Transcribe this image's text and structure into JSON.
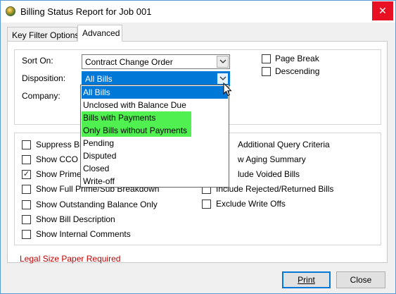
{
  "window": {
    "title": "Billing Status Report for Job 001",
    "close_glyph": "✕"
  },
  "tabs": [
    {
      "label": "Key Filter Options",
      "active": false
    },
    {
      "label": "Advanced",
      "active": true
    }
  ],
  "sort_group": {
    "sort_on_label": "Sort On:",
    "sort_on_value": "Contract Change Order",
    "disposition_label": "Disposition:",
    "disposition_value": "All Bills",
    "company_label": "Company:",
    "page_break_label": "Page Break",
    "page_break_checked": false,
    "descending_label": "Descending",
    "descending_checked": false
  },
  "disposition_dropdown": {
    "options": [
      "All Bills",
      "Unclosed with Balance Due",
      "Bills with Payments",
      "Only Bills without Payments",
      "Pending",
      "Disputed",
      "Closed",
      "Write-off"
    ],
    "selected": "All Bills",
    "highlight_color": "#50f050"
  },
  "options_left": [
    {
      "label": "Suppress Bill",
      "checked": false
    },
    {
      "label": "Show CCO B",
      "checked": false
    },
    {
      "label": "Show Prime/",
      "checked": true
    },
    {
      "label": "Show Full Prime/Sub Breakdown",
      "checked": false
    },
    {
      "label": "Show Outstanding Balance Only",
      "checked": false
    },
    {
      "label": "Show Bill Description",
      "checked": false
    },
    {
      "label": "Show Internal Comments",
      "checked": false
    }
  ],
  "options_right": [
    {
      "label": "Additional Query Criteria",
      "checked": false
    },
    {
      "label": "w Aging Summary",
      "checked": false
    },
    {
      "label": "lude Voided Bills",
      "checked": false
    },
    {
      "label": "Include Rejected/Returned Bills",
      "checked": false
    },
    {
      "label": "Exclude Write Offs",
      "checked": false
    }
  ],
  "footer": {
    "warning": "Legal Size Paper Required",
    "warning_color": "#c00000",
    "print_label": "Print",
    "close_label": "Close"
  },
  "icons": {
    "app": "app-globe-icon",
    "combo_arrow": "chevron-down-icon",
    "check": "✓",
    "cursor": "mouse-pointer-icon"
  }
}
